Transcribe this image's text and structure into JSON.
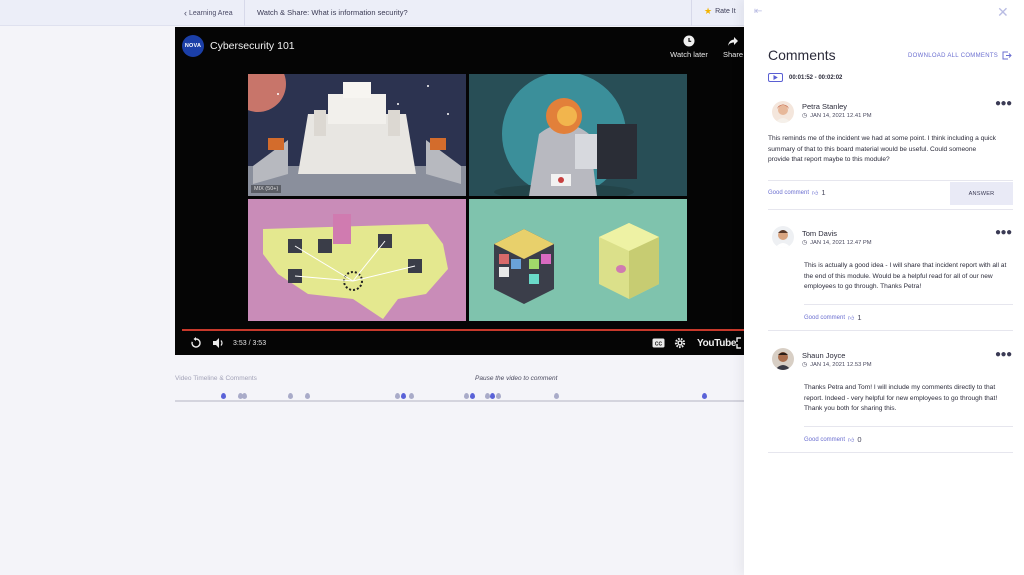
{
  "topbar": {
    "back_label": "Learning Area",
    "page_title": "Watch & Share: What is information security?",
    "rate_label": "Rate It"
  },
  "video": {
    "channel_logo": "NOVA",
    "title": "Cybersecurity 101",
    "watch_later_label": "Watch later",
    "share_label": "Share",
    "live_label": "MIX (50+)",
    "time_display": "3:53 / 3:53",
    "youtube_label": "YouTube",
    "progress_fraction": 1.0
  },
  "timeline": {
    "label": "Video Timeline & Comments",
    "hint": "Pause the video to comment",
    "marker_colors": {
      "active": "#5a62d8",
      "inactive": "#a9abc9"
    }
  },
  "comments_panel": {
    "heading": "Comments",
    "download_label": "DOWNLOAD ALL COMMENTS",
    "time_range": "00:01:52 - 00:02:02",
    "answer_label": "ANSWER",
    "comments": [
      {
        "author": "Petra Stanley",
        "date": "JAN 14, 2021 12.41 PM",
        "text": "This reminds me of the incident we had at some point. I think including a quick summary of that to this board material would be useful. Could someone provide that report maybe to this module?",
        "good_label": "Good comment",
        "likes": "1"
      },
      {
        "author": "Tom Davis",
        "date": "JAN 14, 2021 12.47 PM",
        "text": "This is actually a good idea - I will share that incident report with all at the end of this module. Would be a helpful read for all of our new employees to go through. Thanks Petra!",
        "good_label": "Good comment",
        "likes": "1"
      },
      {
        "author": "Shaun Joyce",
        "date": "JAN 14, 2021 12.53 PM",
        "text": "Thanks Petra and Tom! I will include my comments directly to that report. Indeed - very helpful for new employees to go through that! Thank you both for sharing this.",
        "good_label": "Good comment",
        "likes": "0"
      }
    ]
  },
  "colors": {
    "accent": "#5a62d8",
    "progress": "#c7392b",
    "star": "#f2b300"
  }
}
